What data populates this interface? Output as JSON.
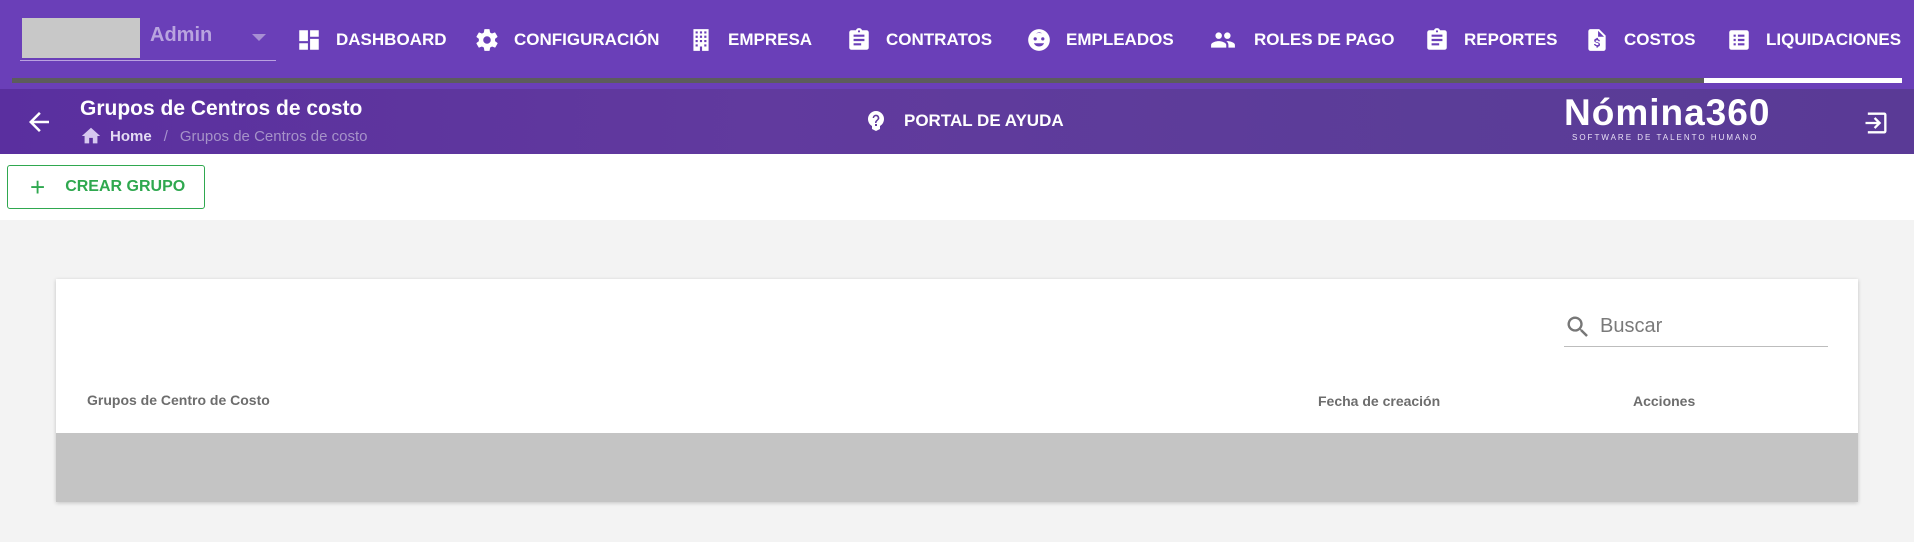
{
  "company": {
    "name": "Admin"
  },
  "nav": {
    "items": [
      {
        "label": "DASHBOARD",
        "icon": "dashboard-icon"
      },
      {
        "label": "CONFIGURACIÓN",
        "icon": "gear-icon"
      },
      {
        "label": "EMPRESA",
        "icon": "building-icon"
      },
      {
        "label": "CONTRATOS",
        "icon": "clipboard-icon"
      },
      {
        "label": "EMPLEADOS",
        "icon": "face-icon"
      },
      {
        "label": "ROLES DE PAGO",
        "icon": "people-icon"
      },
      {
        "label": "REPORTES",
        "icon": "clipboard-icon"
      },
      {
        "label": "COSTOS",
        "icon": "invoice-dollar-icon"
      },
      {
        "label": "LIQUIDACIONES",
        "icon": "list-icon"
      }
    ]
  },
  "header": {
    "title": "Grupos de Centros de costo",
    "breadcrumb": {
      "home": "Home",
      "separator": "/",
      "current": "Grupos de Centros de costo"
    },
    "help_label": "PORTAL DE AYUDA",
    "brand_name": "Nómina360",
    "brand_tagline": "SOFTWARE DE TALENTO HUMANO"
  },
  "actions": {
    "create_label": "CREAR GRUPO",
    "create_symbol": "+"
  },
  "table": {
    "search_placeholder": "Buscar",
    "columns": [
      "Grupos de Centro de Costo",
      "Fecha de creación",
      "Acciones"
    ],
    "rows": []
  },
  "colors": {
    "nav_bg": "#6a3fb8",
    "subheader_bg": "#5a2f9f",
    "accent_green": "#2fa84f",
    "page_bg": "#f3f3f3"
  }
}
